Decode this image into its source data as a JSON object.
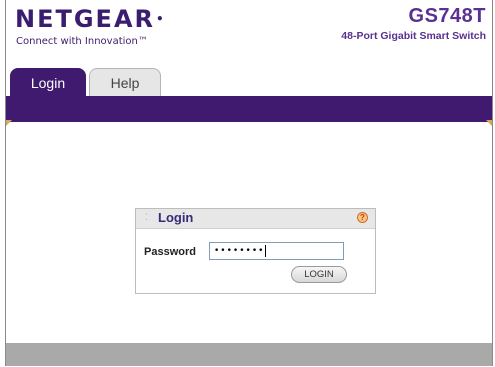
{
  "header": {
    "brand": "NETGEAR",
    "tagline": "Connect with Innovation™",
    "model": "GS748T",
    "model_description": "48-Port Gigabit Smart Switch"
  },
  "tabs": [
    {
      "label": "Login",
      "active": true
    },
    {
      "label": "Help",
      "active": false
    }
  ],
  "login_panel": {
    "title": "Login",
    "password_label": "Password",
    "password_value": "••••••••",
    "button_label": "LOGIN"
  },
  "colors": {
    "brand_purple": "#3f1a6e",
    "accent_gold": "#d7a85a",
    "footer_gray": "#a9a9a9"
  },
  "icons": {
    "help": "help-icon",
    "grip": "grip-icon"
  }
}
